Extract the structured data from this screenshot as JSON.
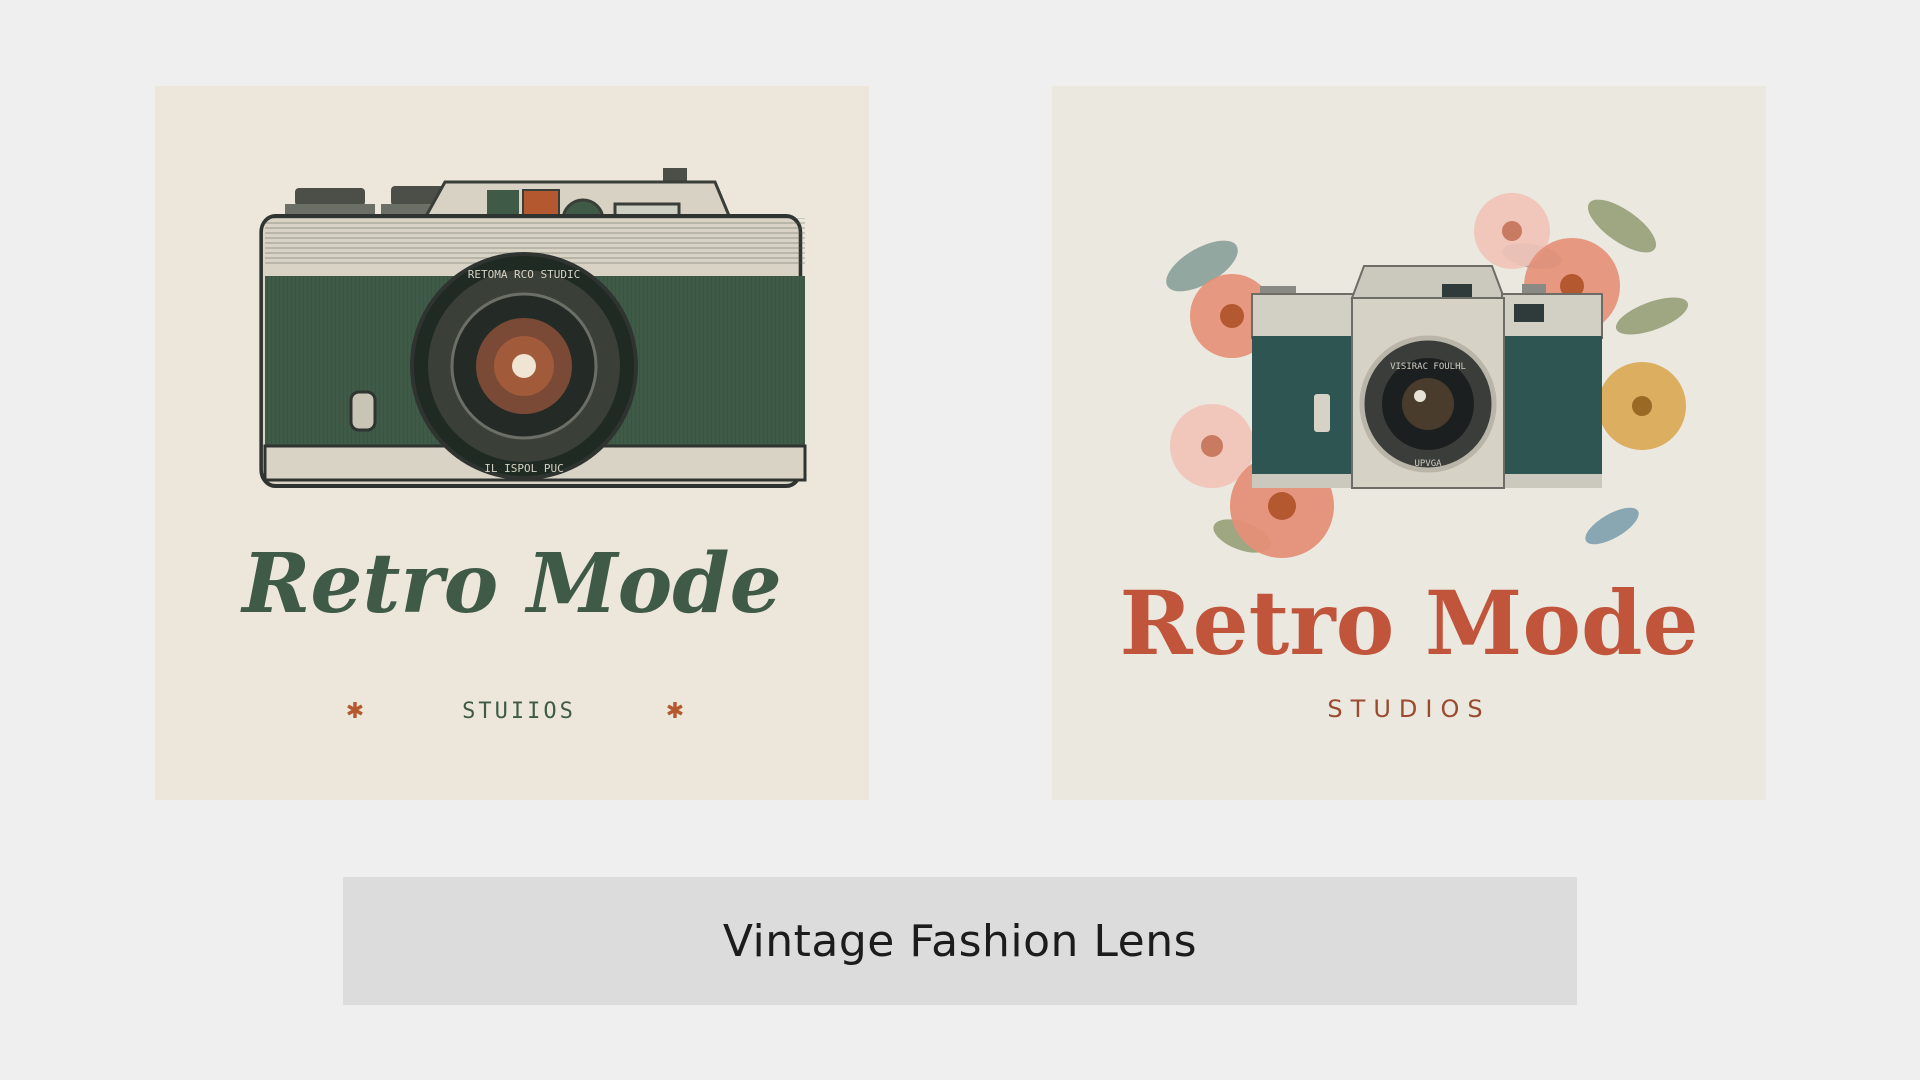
{
  "logos": [
    {
      "variant": "engraved-sketch",
      "title": "Retro Mode",
      "subtitle": "STUIIOS",
      "lens_ring_top": "RETOMA RCO STUDIC",
      "lens_ring_bottom": "IL ISPOL PUC",
      "colors": {
        "background": "#ece7da",
        "ink": "#3f5a47",
        "accent": "#b4592f"
      }
    },
    {
      "variant": "watercolor-floral",
      "title": "Retro Mode",
      "subtitle": "STUDIOS",
      "lens_ring_top": "VISIRAC FOULHL",
      "lens_ring_bottom": "UPVGA",
      "colors": {
        "background": "#ebe8df",
        "title": "#c1553c",
        "subtitle": "#9a4a2f",
        "body": "#2f5552"
      }
    }
  ],
  "caption": "Vintage Fashion Lens"
}
